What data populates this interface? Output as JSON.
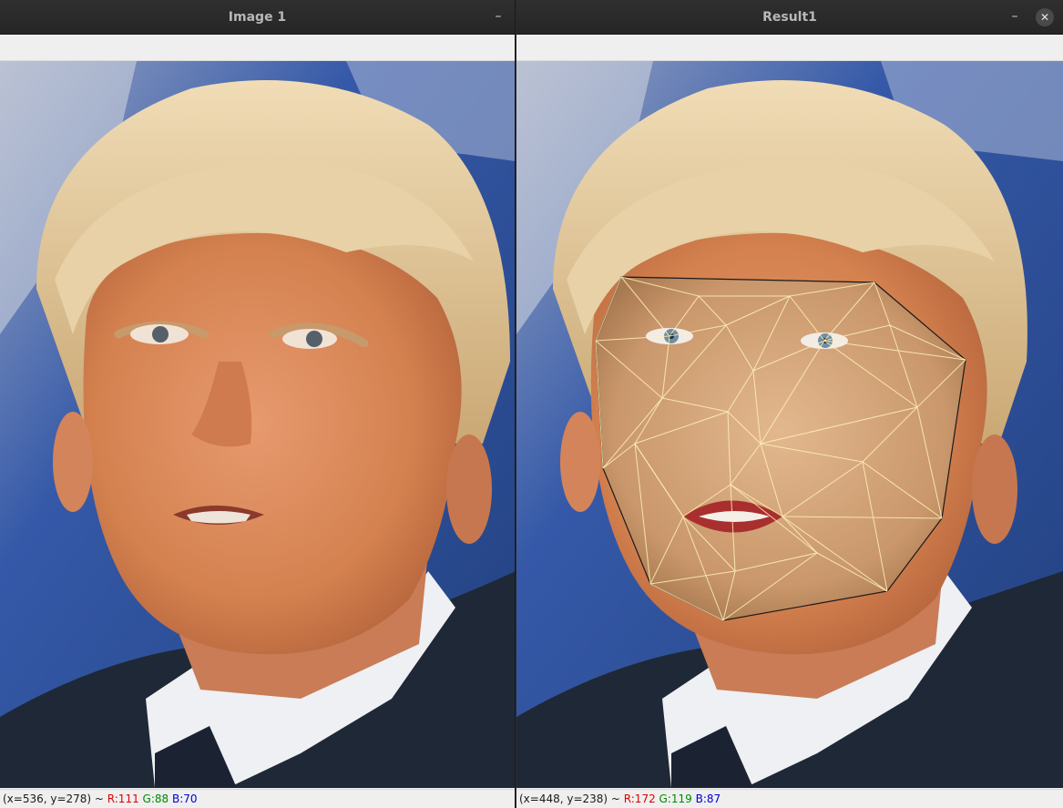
{
  "windows": [
    {
      "title": "Image 1",
      "status": {
        "coords": "(x=536, y=278) ~ ",
        "r": "R:111",
        "g": "G:88",
        "b": "B:70"
      }
    },
    {
      "title": "Result1",
      "status": {
        "coords": "(x=448, y=238) ~ ",
        "r": "R:172",
        "g": "G:119",
        "b": "B:87"
      }
    }
  ],
  "icons": {
    "minimize": "minimize-icon",
    "close": "close-icon"
  },
  "glyphs": {
    "minimize": "–",
    "close": "✕"
  },
  "colors": {
    "background_blue": "#2f4f9a",
    "skin": "#d9875e",
    "hair": "#e2c79a",
    "suit": "#1f2836",
    "mesh_lines": "#fff2b8"
  }
}
